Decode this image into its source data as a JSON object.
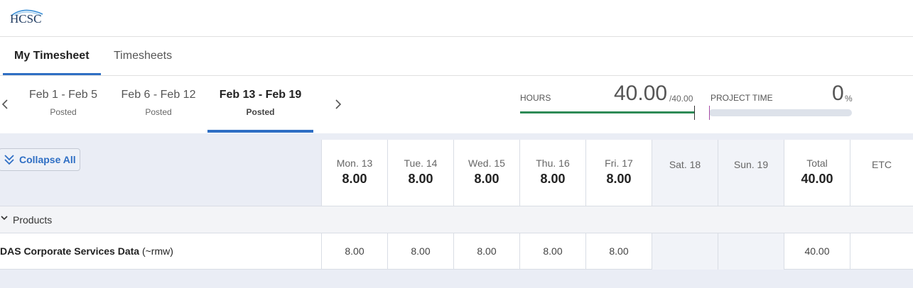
{
  "app": {
    "logo_text": "HCSC"
  },
  "tabs": [
    {
      "label": "My Timesheet",
      "active": true
    },
    {
      "label": "Timesheets",
      "active": false
    }
  ],
  "weeks": [
    {
      "range": "Feb 1 - Feb 5",
      "status": "Posted"
    },
    {
      "range": "Feb 6 - Feb 12",
      "status": "Posted"
    },
    {
      "range": "Feb 13 - Feb 19",
      "status": "Posted",
      "active": true
    }
  ],
  "hours_meter": {
    "label": "HOURS",
    "value": "40.00",
    "max": "/40.00",
    "fill": 1.0,
    "color": "#2e8b57"
  },
  "project_meter": {
    "label": "PROJECT TIME",
    "value": "0",
    "unit": "%",
    "fill": 0.0
  },
  "grid": {
    "collapse_label": "Collapse All",
    "days": [
      {
        "name": "Mon. 13",
        "hours": "8.00"
      },
      {
        "name": "Tue. 14",
        "hours": "8.00"
      },
      {
        "name": "Wed. 15",
        "hours": "8.00"
      },
      {
        "name": "Thu. 16",
        "hours": "8.00"
      },
      {
        "name": "Fri. 17",
        "hours": "8.00"
      },
      {
        "name": "Sat. 18",
        "hours": ""
      },
      {
        "name": "Sun. 19",
        "hours": ""
      },
      {
        "name": "Total",
        "hours": "40.00"
      },
      {
        "name": "ETC",
        "hours": ""
      }
    ],
    "section_label": "Products",
    "row": {
      "name_bold": "DAS Corporate Services Data",
      "name_suffix": " (~rmw)",
      "cells": [
        "8.00",
        "8.00",
        "8.00",
        "8.00",
        "8.00",
        "",
        "",
        "40.00",
        ""
      ]
    }
  },
  "colors": {
    "accent": "#2f6fc4",
    "hours_bar": "#2e8b57",
    "marker": "#a64ca6"
  }
}
